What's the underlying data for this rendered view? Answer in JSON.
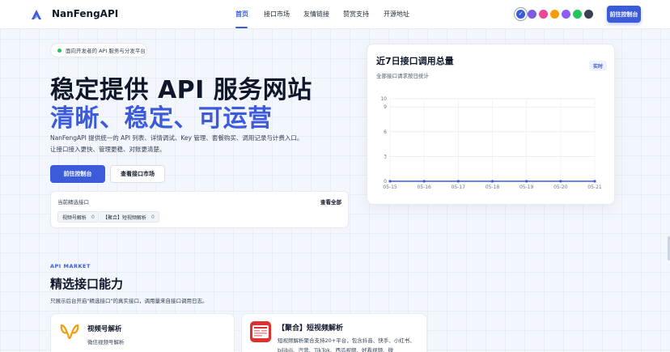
{
  "header": {
    "brand": "NanFengAPI",
    "nav": [
      {
        "label": "首页",
        "active": true
      },
      {
        "label": "接口市场"
      },
      {
        "label": "友情链接"
      },
      {
        "label": "赞赏支持"
      },
      {
        "label": "开源地址"
      }
    ],
    "theme_colors": [
      "#3b5bdb",
      "#7c5ce0",
      "#ec4899",
      "#f59e0b",
      "#8b5cf6",
      "#22c55e",
      "#374151"
    ],
    "console_button": "前往控制台"
  },
  "hero": {
    "pill": "面向开发者的 API 服务与分发平台",
    "title": "稳定提供 API 服务网站",
    "subtitle": "清晰、稳定、可运营",
    "description": "NanFengAPI 提供统一的 API 列表、详情调试、Key 管理、套餐购买、调用记录与计费入口。让接口接入更快、管理更稳、对账更清楚。",
    "primary_button": "前往控制台",
    "secondary_button": "查看接口市场"
  },
  "featured": {
    "label": "当前精选接口",
    "view_all": "查看全部",
    "items": [
      {
        "name": "视频号解析",
        "count": "0"
      },
      {
        "name": "【聚合】短视频解析",
        "count": "0"
      }
    ]
  },
  "chart_data": {
    "type": "line",
    "title": "近7日接口调用总量",
    "subtitle": "全部接口请求按日统计",
    "badge": "实时",
    "categories": [
      "05-15",
      "05-16",
      "05-17",
      "05-18",
      "05-19",
      "05-20",
      "05-21"
    ],
    "series": [
      {
        "values": [
          0,
          0,
          0,
          0,
          0,
          0,
          0
        ]
      }
    ],
    "yticks": [
      "0",
      "3",
      "6",
      "9",
      "10"
    ],
    "ylim": [
      0,
      10
    ],
    "grid": true,
    "color": "#3b5bdb"
  },
  "api_market": {
    "tag": "API MARKET",
    "title": "精选接口能力",
    "description": "只展示后台开启\"精选接口\"的真实接口，调用量来自接口调用日志。",
    "cards": [
      {
        "title": "视频号解析",
        "desc": "微信视频号解析"
      },
      {
        "title": "【聚合】短视频解析",
        "desc": "短视频解析聚合支持20+平台，包含抖音、快手、小红书、bilibili、汽营、TikTok、西瓜视频、好看视频、微"
      }
    ]
  }
}
